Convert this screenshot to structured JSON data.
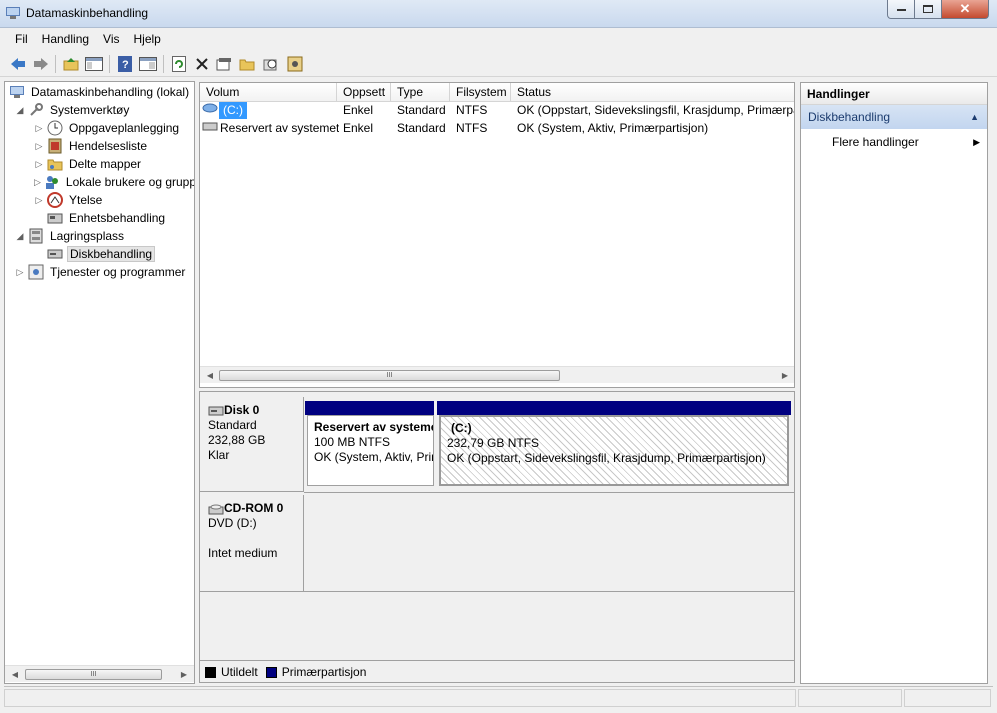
{
  "window": {
    "title": "Datamaskinbehandling"
  },
  "menu": {
    "items": [
      "Fil",
      "Handling",
      "Vis",
      "Hjelp"
    ]
  },
  "toolbar": {
    "icons": [
      "back-arrow-icon",
      "forward-arrow-icon",
      "up-folder-icon",
      "show-hide-tree-icon",
      "help-icon",
      "console-view-icon",
      "refresh-icon",
      "delete-icon",
      "properties-icon",
      "open-icon",
      "search-disk-icon",
      "settings-icon"
    ]
  },
  "tree": {
    "root": "Datamaskinbehandling (lokal)",
    "systemtools": "Systemverktøy",
    "scheduler": "Oppgaveplanlegging",
    "eventlog": "Hendelsesliste",
    "shared": "Delte mapper",
    "users": "Lokale brukere og grupper",
    "performance": "Ytelse",
    "devmgr": "Enhetsbehandling",
    "storage": "Lagringsplass",
    "diskmgmt": "Diskbehandling",
    "services": "Tjenester og programmer"
  },
  "volumes": {
    "columns": [
      "Volum",
      "Oppsett",
      "Type",
      "Filsystem",
      "Status"
    ],
    "rows": [
      {
        "name": "(C:)",
        "layout": "Enkel",
        "type": "Standard",
        "fs": "NTFS",
        "status": "OK (Oppstart, Sidevekslingsfil, Krasjdump, Primærpartisjon)"
      },
      {
        "name": "Reservert av systemet",
        "layout": "Enkel",
        "type": "Standard",
        "fs": "NTFS",
        "status": "OK (System, Aktiv, Primærpartisjon)"
      }
    ]
  },
  "disks": {
    "disk0": {
      "name": "Disk 0",
      "type": "Standard",
      "size": "232,88 GB",
      "state": "Klar"
    },
    "part1": {
      "name": "Reservert av systemet",
      "size": "100 MB NTFS",
      "status": "OK (System, Aktiv, Primærpartisjon)"
    },
    "part2": {
      "name": "(C:)",
      "size": "232,79 GB NTFS",
      "status": "OK (Oppstart, Sidevekslingsfil, Krasjdump, Primærpartisjon)"
    },
    "cdrom": {
      "name": "CD-ROM 0",
      "type": "DVD (D:)",
      "state": "Intet medium"
    }
  },
  "legend": {
    "unallocated": "Utildelt",
    "primary": "Primærpartisjon",
    "unallocated_color": "#000000",
    "primary_color": "#000080"
  },
  "actions": {
    "title": "Handlinger",
    "section": "Diskbehandling",
    "more": "Flere handlinger"
  },
  "scroll": {
    "grip": "III"
  }
}
